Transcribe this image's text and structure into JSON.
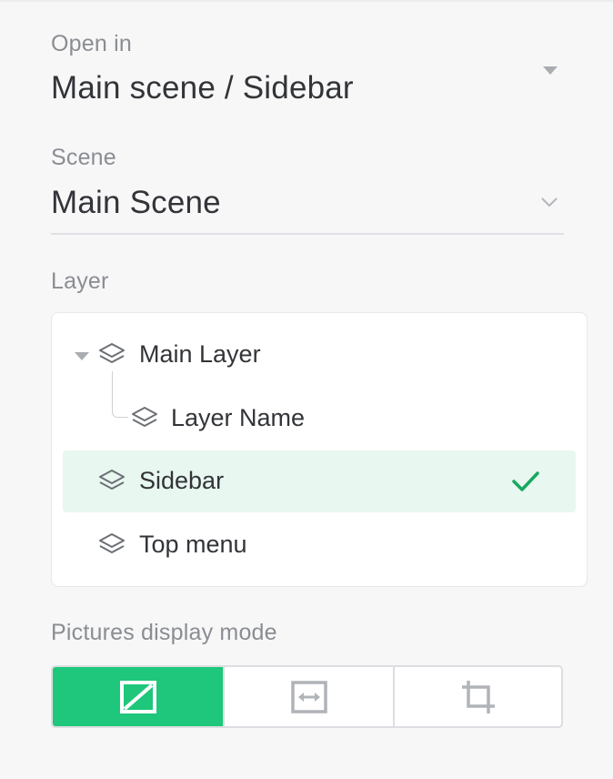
{
  "open_in": {
    "label": "Open in",
    "value": "Main scene / Sidebar"
  },
  "scene": {
    "label": "Scene",
    "value": "Main Scene"
  },
  "layer": {
    "label": "Layer",
    "items": [
      {
        "label": "Main Layer",
        "expanded": true,
        "selected": false
      },
      {
        "label": "Layer Name",
        "child_of": "Main Layer",
        "selected": false
      },
      {
        "label": "Sidebar",
        "selected": true
      },
      {
        "label": "Top menu",
        "selected": false
      }
    ]
  },
  "pictures_display_mode": {
    "label": "Pictures display mode",
    "options": [
      {
        "icon": "no-scale-icon",
        "active": true
      },
      {
        "icon": "fit-width-icon",
        "active": false
      },
      {
        "icon": "crop-icon",
        "active": false
      }
    ]
  },
  "colors": {
    "accent": "#1ec77b",
    "selected_row_bg": "#e8f7f0",
    "check": "#17a862",
    "label_gray": "#8a8d92",
    "text_dark": "#323438"
  }
}
